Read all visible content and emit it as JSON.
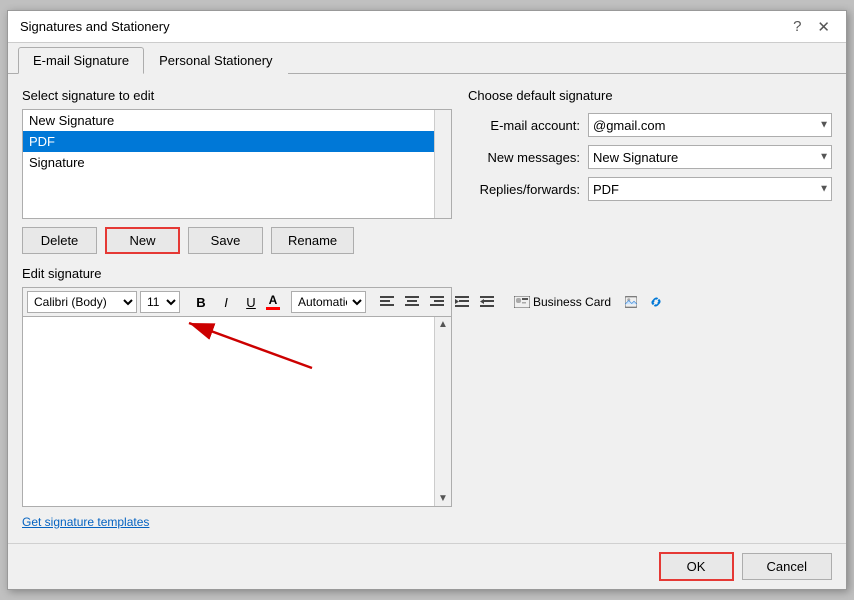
{
  "dialog": {
    "title": "Signatures and Stationery",
    "help_btn": "?",
    "close_btn": "✕"
  },
  "tabs": [
    {
      "id": "email-signature",
      "label": "E-mail Signature",
      "active": true
    },
    {
      "id": "personal-stationery",
      "label": "Personal Stationery",
      "active": false
    }
  ],
  "left": {
    "select_label": "Select signature to edit",
    "signatures": [
      {
        "id": "new-signature",
        "name": "New Signature",
        "selected": false
      },
      {
        "id": "pdf",
        "name": "PDF",
        "selected": true
      },
      {
        "id": "signature",
        "name": "Signature",
        "selected": false
      }
    ],
    "buttons": {
      "delete": "Delete",
      "new": "New",
      "save": "Save",
      "rename": "Rename"
    },
    "edit_label": "Edit signature",
    "toolbar": {
      "font": "Calibri (Body)",
      "size": "11",
      "bold": "B",
      "italic": "I",
      "underline": "U",
      "font_color": "A",
      "color_bar_color": "#ff0000",
      "align_left": "≡",
      "align_center": "≡",
      "align_right": "≡",
      "indent": "⇥",
      "outdent": "⇤",
      "business_card": "Business Card",
      "picture_icon": "🖼",
      "hyperlink_icon": "🔗",
      "auto_color": "Automatic"
    },
    "get_templates": "Get signature templates"
  },
  "right": {
    "choose_label": "Choose default signature",
    "email_account_label": "E-mail account:",
    "email_account_value": "@gmail.com",
    "new_messages_label": "New messages:",
    "new_messages_value": "New Signature",
    "replies_forwards_label": "Replies/forwards:",
    "replies_forwards_value": "PDF",
    "email_options": [
      "@gmail.com"
    ],
    "new_msg_options": [
      "New Signature",
      "PDF",
      "Signature"
    ],
    "replies_options": [
      "PDF",
      "New Signature",
      "Signature"
    ]
  },
  "footer": {
    "ok": "OK",
    "cancel": "Cancel"
  }
}
